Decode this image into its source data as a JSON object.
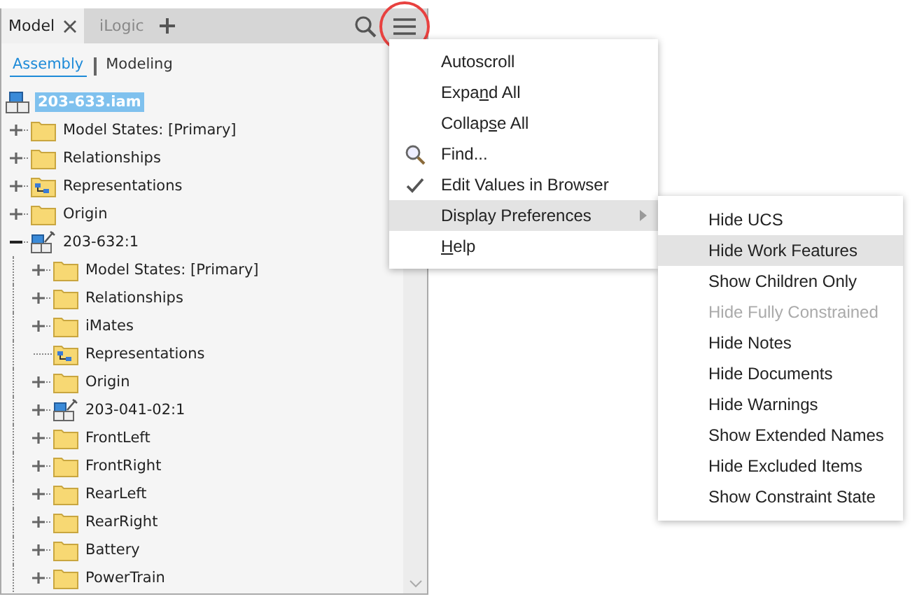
{
  "tabs": [
    {
      "label": "Model",
      "selected": true,
      "closable": true
    },
    {
      "label": "iLogic",
      "selected": false,
      "closable": false
    }
  ],
  "view_tabs": [
    {
      "label": "Assembly",
      "selected": true
    },
    {
      "label": "Modeling",
      "selected": false
    }
  ],
  "tree": {
    "label": "203-633.iam",
    "kind": "assembly",
    "selected": true,
    "children": [
      {
        "label": "Model States: [Primary]",
        "kind": "folder",
        "expanded": false
      },
      {
        "label": "Relationships",
        "kind": "folder",
        "expanded": false
      },
      {
        "label": "Representations",
        "kind": "rep-folder",
        "expanded": false
      },
      {
        "label": "Origin",
        "kind": "folder",
        "expanded": false
      },
      {
        "label": "203-632:1",
        "kind": "subassembly",
        "expanded": true,
        "children": [
          {
            "label": "Model States: [Primary]",
            "kind": "folder",
            "expanded": false
          },
          {
            "label": "Relationships",
            "kind": "folder",
            "expanded": false
          },
          {
            "label": "iMates",
            "kind": "folder",
            "expanded": false
          },
          {
            "label": "Representations",
            "kind": "rep-folder"
          },
          {
            "label": "Origin",
            "kind": "folder",
            "expanded": false
          },
          {
            "label": "203-041-02:1",
            "kind": "subassembly",
            "expanded": false
          },
          {
            "label": "FrontLeft",
            "kind": "folder",
            "expanded": false
          },
          {
            "label": "FrontRight",
            "kind": "folder",
            "expanded": false
          },
          {
            "label": "RearLeft",
            "kind": "folder",
            "expanded": false
          },
          {
            "label": "RearRight",
            "kind": "folder",
            "expanded": false
          },
          {
            "label": "Battery",
            "kind": "folder",
            "expanded": false
          },
          {
            "label": "PowerTrain",
            "kind": "folder",
            "expanded": false
          }
        ]
      }
    ]
  },
  "menu": [
    {
      "kind": "plain",
      "pre": "Autoscroll",
      "selected": false
    },
    {
      "kind": "plain",
      "pre": "Expa",
      "accel": "n",
      "post": "d All",
      "selected": false
    },
    {
      "kind": "plain",
      "pre": "Collap",
      "accel": "s",
      "post": "e All",
      "selected": false
    },
    {
      "kind": "search",
      "pre": "Find...",
      "selected": false
    },
    {
      "kind": "plain",
      "pre": "Edit Values in Browser",
      "checked": true,
      "selected": false
    },
    {
      "kind": "plain",
      "pre": "Display Preferences",
      "submenu": true,
      "selected": true
    },
    {
      "kind": "plain",
      "accel": "H",
      "post": "elp",
      "selected": false
    }
  ],
  "submenu": [
    {
      "label": "Hide UCS",
      "selected": false,
      "disabled": false
    },
    {
      "label": "Hide Work Features",
      "selected": true,
      "disabled": false
    },
    {
      "label": "Show Children Only",
      "selected": false,
      "disabled": false
    },
    {
      "label": "Hide Fully Constrained",
      "selected": false,
      "disabled": true
    },
    {
      "label": "Hide Notes",
      "selected": false,
      "disabled": false
    },
    {
      "label": "Hide Documents",
      "selected": false,
      "disabled": false
    },
    {
      "label": "Hide Warnings",
      "selected": false,
      "disabled": false
    },
    {
      "label": "Show Extended Names",
      "selected": false,
      "disabled": false
    },
    {
      "label": "Hide Excluded Items",
      "selected": false,
      "disabled": false
    },
    {
      "label": "Show Constraint State",
      "selected": false,
      "disabled": false
    }
  ]
}
